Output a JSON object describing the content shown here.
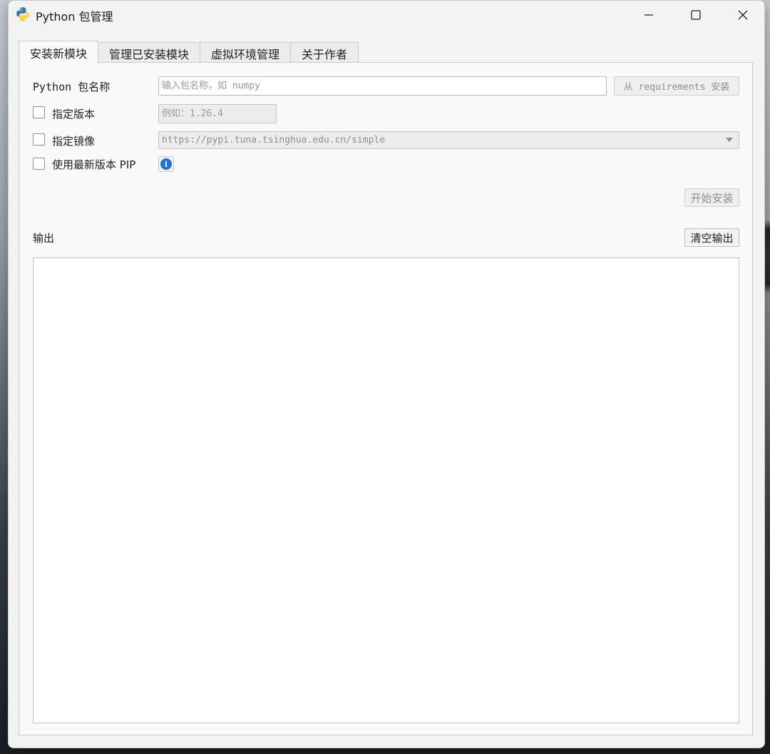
{
  "window": {
    "title": "Python 包管理"
  },
  "tabs": [
    {
      "label": "安装新模块",
      "active": true
    },
    {
      "label": "管理已安装模块",
      "active": false
    },
    {
      "label": "虚拟环境管理",
      "active": false
    },
    {
      "label": "关于作者",
      "active": false
    }
  ],
  "install": {
    "package_label": "Python 包名称",
    "package_placeholder": "输入包名称，如 numpy",
    "requirements_button": "从 requirements 安装",
    "version_label": "指定版本",
    "version_placeholder": "例如：1.26.4",
    "version_checked": false,
    "mirror_label": "指定镜像",
    "mirror_value": "https://pypi.tuna.tsinghua.edu.cn/simple",
    "mirror_checked": false,
    "latest_pip_label": "使用最新版本 PIP",
    "latest_pip_checked": false,
    "install_button": "开始安装",
    "output_label": "输出",
    "clear_button": "清空输出",
    "output_text": ""
  },
  "colors": {
    "info_accent": "#1a73d9",
    "python_blue": "#3776ab",
    "python_yellow": "#ffd43b"
  }
}
